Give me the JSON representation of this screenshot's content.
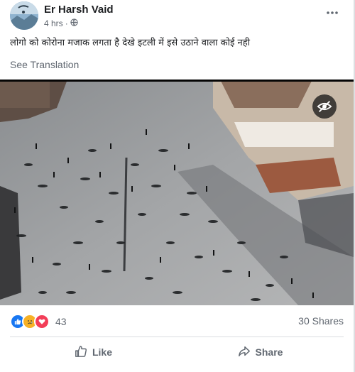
{
  "post": {
    "author": "Er Harsh Vaid",
    "time": "4 hrs",
    "separator": "·",
    "text": "लोगो  को कोरोना मजाक लगता है देखे इटली में इसे उठाने वाला कोई नही",
    "see_translation": "See Translation"
  },
  "media": {
    "subject": "aerial view of a city square with people lying on the pavement",
    "overlay_icon": "eye-slash-icon"
  },
  "stats": {
    "reaction_icons": [
      "like-icon",
      "sad-icon",
      "love-icon"
    ],
    "reaction_count": "43",
    "shares": "30 Shares"
  },
  "actions": {
    "like": "Like",
    "share": "Share"
  },
  "colors": {
    "text_primary": "#1c1e21",
    "text_secondary": "#606770",
    "like_blue": "#1877f2",
    "love_red": "#f33e58",
    "sad_yellow": "#f7b125"
  }
}
